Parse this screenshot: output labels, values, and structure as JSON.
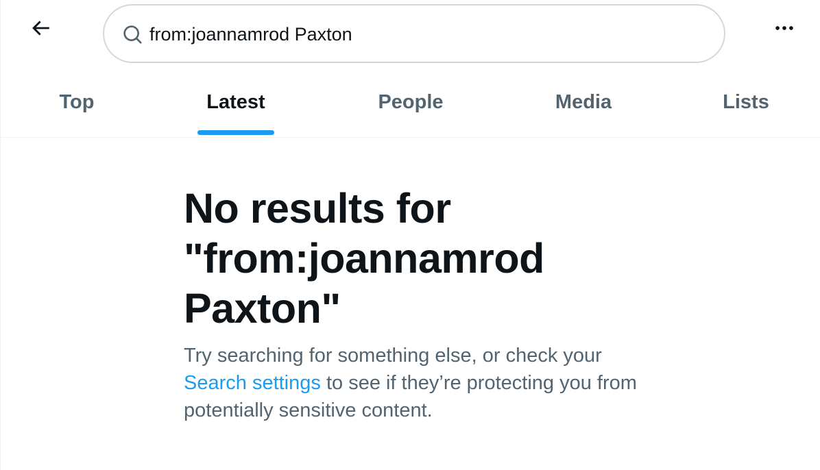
{
  "header": {
    "search_value": "from:joannamrod Paxton",
    "back_icon": "arrow-left-icon",
    "search_icon": "search-icon",
    "more_icon": "more-horizontal-icon"
  },
  "tabs": [
    {
      "label": "Top",
      "active": false
    },
    {
      "label": "Latest",
      "active": true
    },
    {
      "label": "People",
      "active": false
    },
    {
      "label": "Media",
      "active": false
    },
    {
      "label": "Lists",
      "active": false
    }
  ],
  "empty_state": {
    "title_line1": "No results for",
    "title_line2": "\"from:joannamrod",
    "title_line3": "Paxton\"",
    "desc_before_link": "Try searching for something else, or check your ",
    "desc_link": "Search settings",
    "desc_after_link": " to see if they’re protecting you from potentially sensitive content."
  },
  "colors": {
    "accent": "#1d9bf0",
    "text_primary": "#0f1419",
    "text_secondary": "#536471",
    "border": "#cfd9de"
  }
}
